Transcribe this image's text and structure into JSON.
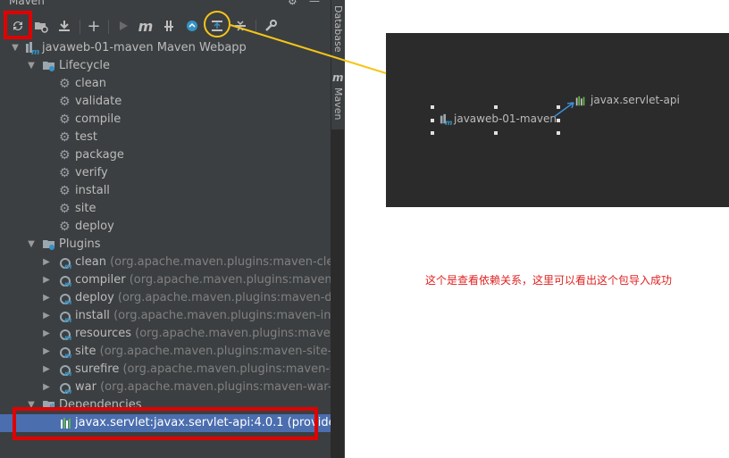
{
  "panel": {
    "title": "Maven",
    "side_tabs": [
      "Database",
      "Maven"
    ]
  },
  "toolbar": {
    "buttons": [
      {
        "name": "reload-all-projects",
        "icon": "reload-icon"
      },
      {
        "name": "generate-sources",
        "icon": "folder-gear-icon"
      },
      {
        "name": "download-sources",
        "icon": "download-icon"
      },
      {
        "name": "add-maven-project",
        "icon": "plus-icon"
      },
      {
        "name": "run-maven-build",
        "icon": "run-icon"
      },
      {
        "name": "execute-maven-goal",
        "icon": "maven-m-icon"
      },
      {
        "name": "toggle-offline-mode",
        "icon": "offline-icon"
      },
      {
        "name": "toggle-skip-tests",
        "icon": "skip-tests-icon"
      },
      {
        "name": "show-dependencies",
        "icon": "show-dependencies-icon"
      },
      {
        "name": "collapse-all",
        "icon": "collapse-all-icon"
      },
      {
        "name": "maven-settings",
        "icon": "wrench-icon"
      }
    ]
  },
  "tree": {
    "project": "javaweb-01-maven Maven Webapp",
    "lifecycle": {
      "label": "Lifecycle",
      "items": [
        "clean",
        "validate",
        "compile",
        "test",
        "package",
        "verify",
        "install",
        "site",
        "deploy"
      ]
    },
    "plugins": {
      "label": "Plugins",
      "items": [
        {
          "name": "clean",
          "detail": "(org.apache.maven.plugins:maven-clean-plu"
        },
        {
          "name": "compiler",
          "detail": "(org.apache.maven.plugins:maven-comp"
        },
        {
          "name": "deploy",
          "detail": "(org.apache.maven.plugins:maven-deploy"
        },
        {
          "name": "install",
          "detail": "(org.apache.maven.plugins:maven-install-p"
        },
        {
          "name": "resources",
          "detail": "(org.apache.maven.plugins:maven-reso"
        },
        {
          "name": "site",
          "detail": "(org.apache.maven.plugins:maven-site-plugi"
        },
        {
          "name": "surefire",
          "detail": "(org.apache.maven.plugins:maven-surefir"
        },
        {
          "name": "war",
          "detail": "(org.apache.maven.plugins:maven-war-plugi"
        }
      ]
    },
    "dependencies": {
      "label": "Dependencies",
      "items": [
        {
          "name": "javax.servlet:javax.servlet-api:4.0.1",
          "detail": "(provided)"
        }
      ]
    }
  },
  "graph": {
    "node_project": "javaweb-01-maven",
    "node_dependency": "javax.servlet-api"
  },
  "annotation": "这个是查看依赖关系，这里可以看出这个包导入成功",
  "colors": {
    "panel_bg": "#3c3f41",
    "selection": "#4b6eaf",
    "highlight_box": "#e00000",
    "highlight_circle": "#f5c518",
    "annotation_text": "#e02020",
    "graph_bg": "#2b2b2b"
  }
}
